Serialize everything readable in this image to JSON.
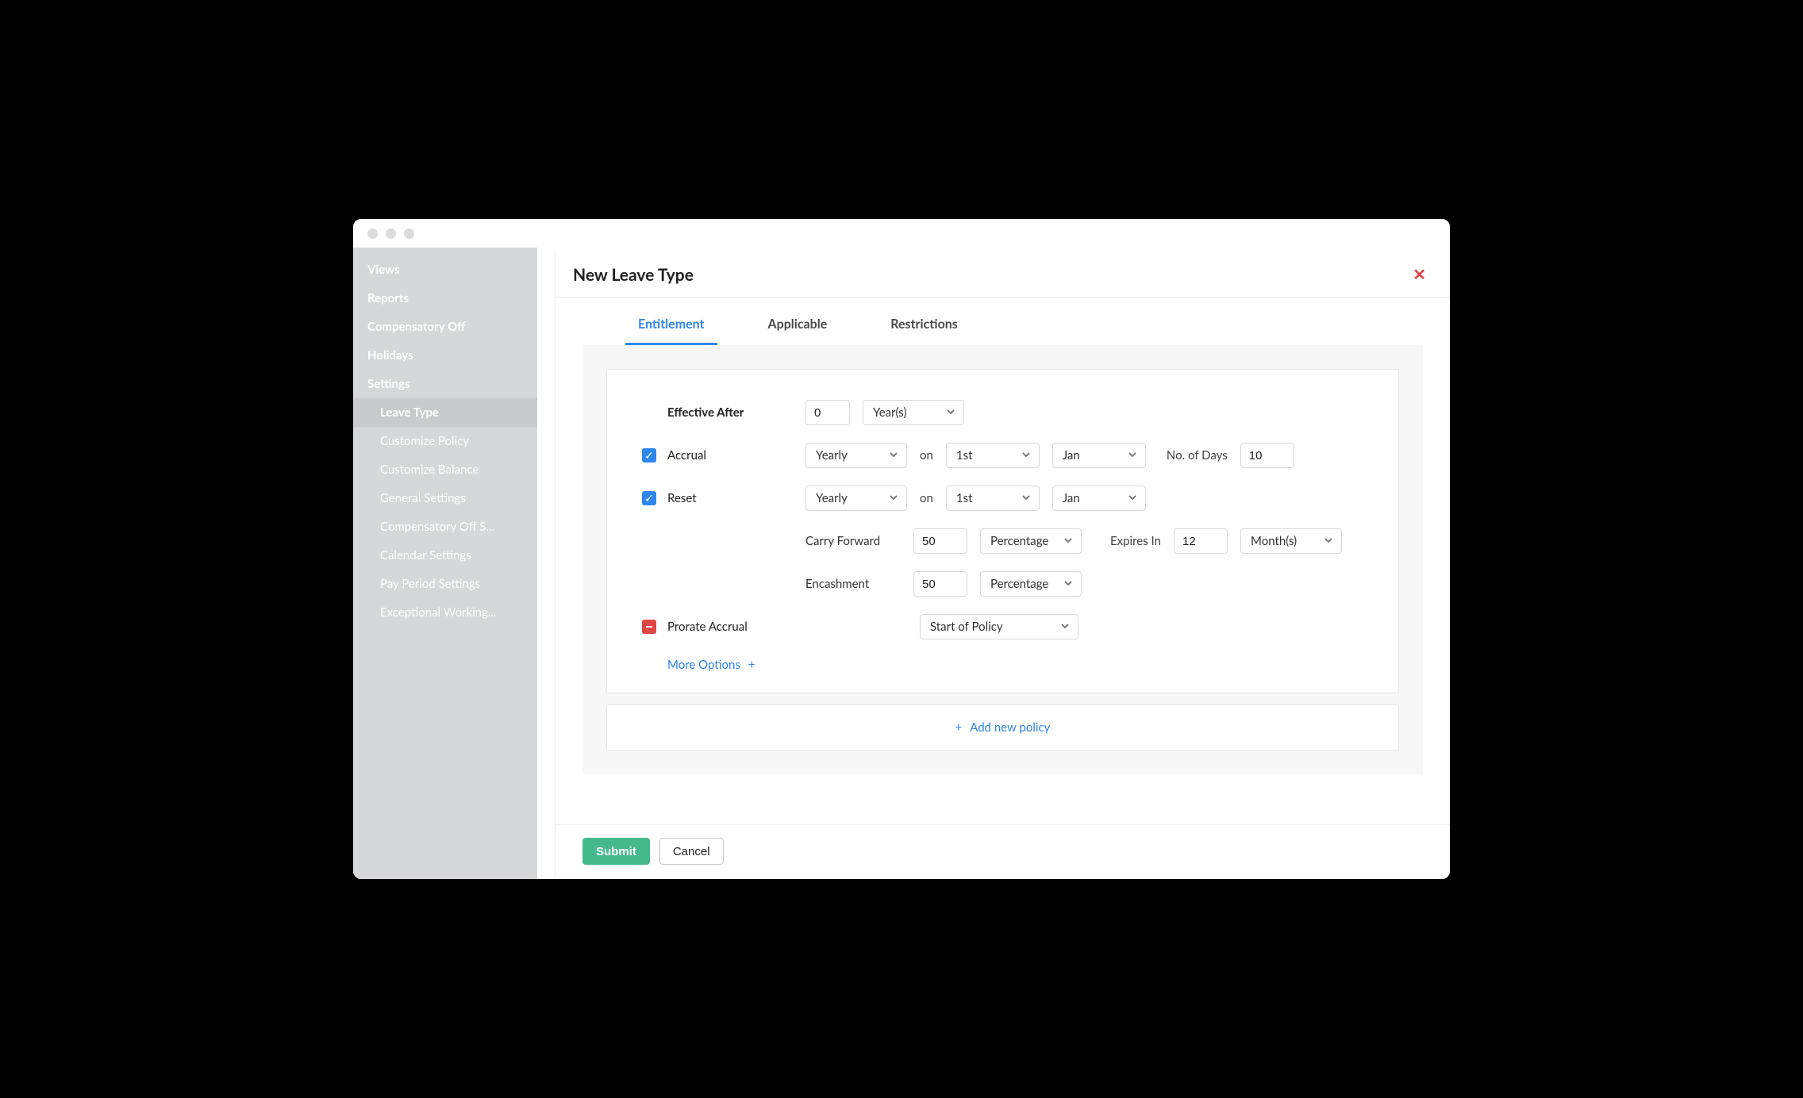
{
  "sidebar": {
    "items": [
      {
        "label": "Views"
      },
      {
        "label": "Reports"
      },
      {
        "label": "Compensatory Off"
      },
      {
        "label": "Holidays"
      },
      {
        "label": "Settings"
      }
    ],
    "subitems": [
      {
        "label": "Leave Type",
        "active": true
      },
      {
        "label": "Customize Policy"
      },
      {
        "label": "Customize Balance"
      },
      {
        "label": "General Settings"
      },
      {
        "label": "Compensatory Off S..."
      },
      {
        "label": "Calendar Settings"
      },
      {
        "label": "Pay Period Settings"
      },
      {
        "label": "Exceptional Working..."
      }
    ]
  },
  "header": {
    "title": "New Leave Type"
  },
  "tabs": [
    {
      "label": "Entitlement",
      "active": true
    },
    {
      "label": "Applicable"
    },
    {
      "label": "Restrictions"
    }
  ],
  "form": {
    "effective_after": {
      "label": "Effective After",
      "value": "0",
      "unit": "Year(s)"
    },
    "accrual": {
      "label": "Accrual",
      "period": "Yearly",
      "on_label": "on",
      "day": "1st",
      "month": "Jan",
      "no_of_days_label": "No. of Days",
      "no_of_days_value": "10"
    },
    "reset": {
      "label": "Reset",
      "period": "Yearly",
      "on_label": "on",
      "day": "1st",
      "month": "Jan"
    },
    "carry_forward": {
      "label": "Carry Forward",
      "value": "50",
      "unit": "Percentage",
      "expires_label": "Expires In",
      "expires_value": "12",
      "expires_unit": "Month(s)"
    },
    "encashment": {
      "label": "Encashment",
      "value": "50",
      "unit": "Percentage"
    },
    "prorate": {
      "label": "Prorate Accrual",
      "option": "Start of Policy"
    },
    "more_options_label": "More Options",
    "add_policy_label": "Add new policy"
  },
  "footer": {
    "submit": "Submit",
    "cancel": "Cancel"
  }
}
